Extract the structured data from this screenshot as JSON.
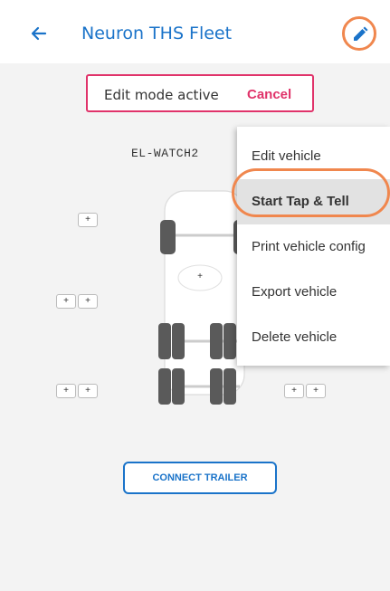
{
  "header": {
    "title": "Neuron THS Fleet",
    "back_icon": "arrow-left-icon",
    "edit_icon": "pencil-icon",
    "accent_color": "#1a73c9",
    "highlight_color": "#f0874e"
  },
  "banner": {
    "text": "Edit mode active",
    "cancel_label": "Cancel",
    "border_color": "#e0336a"
  },
  "vehicle": {
    "id": "EL-WATCH2",
    "add_label": "+",
    "center_add_label": "+"
  },
  "menu": {
    "items": [
      {
        "label": "Edit vehicle"
      },
      {
        "label": "Start Tap & Tell"
      },
      {
        "label": "Print vehicle config"
      },
      {
        "label": "Export vehicle"
      },
      {
        "label": "Delete vehicle"
      }
    ],
    "selected_index": 1
  },
  "connect_trailer_label": "CONNECT TRAILER"
}
